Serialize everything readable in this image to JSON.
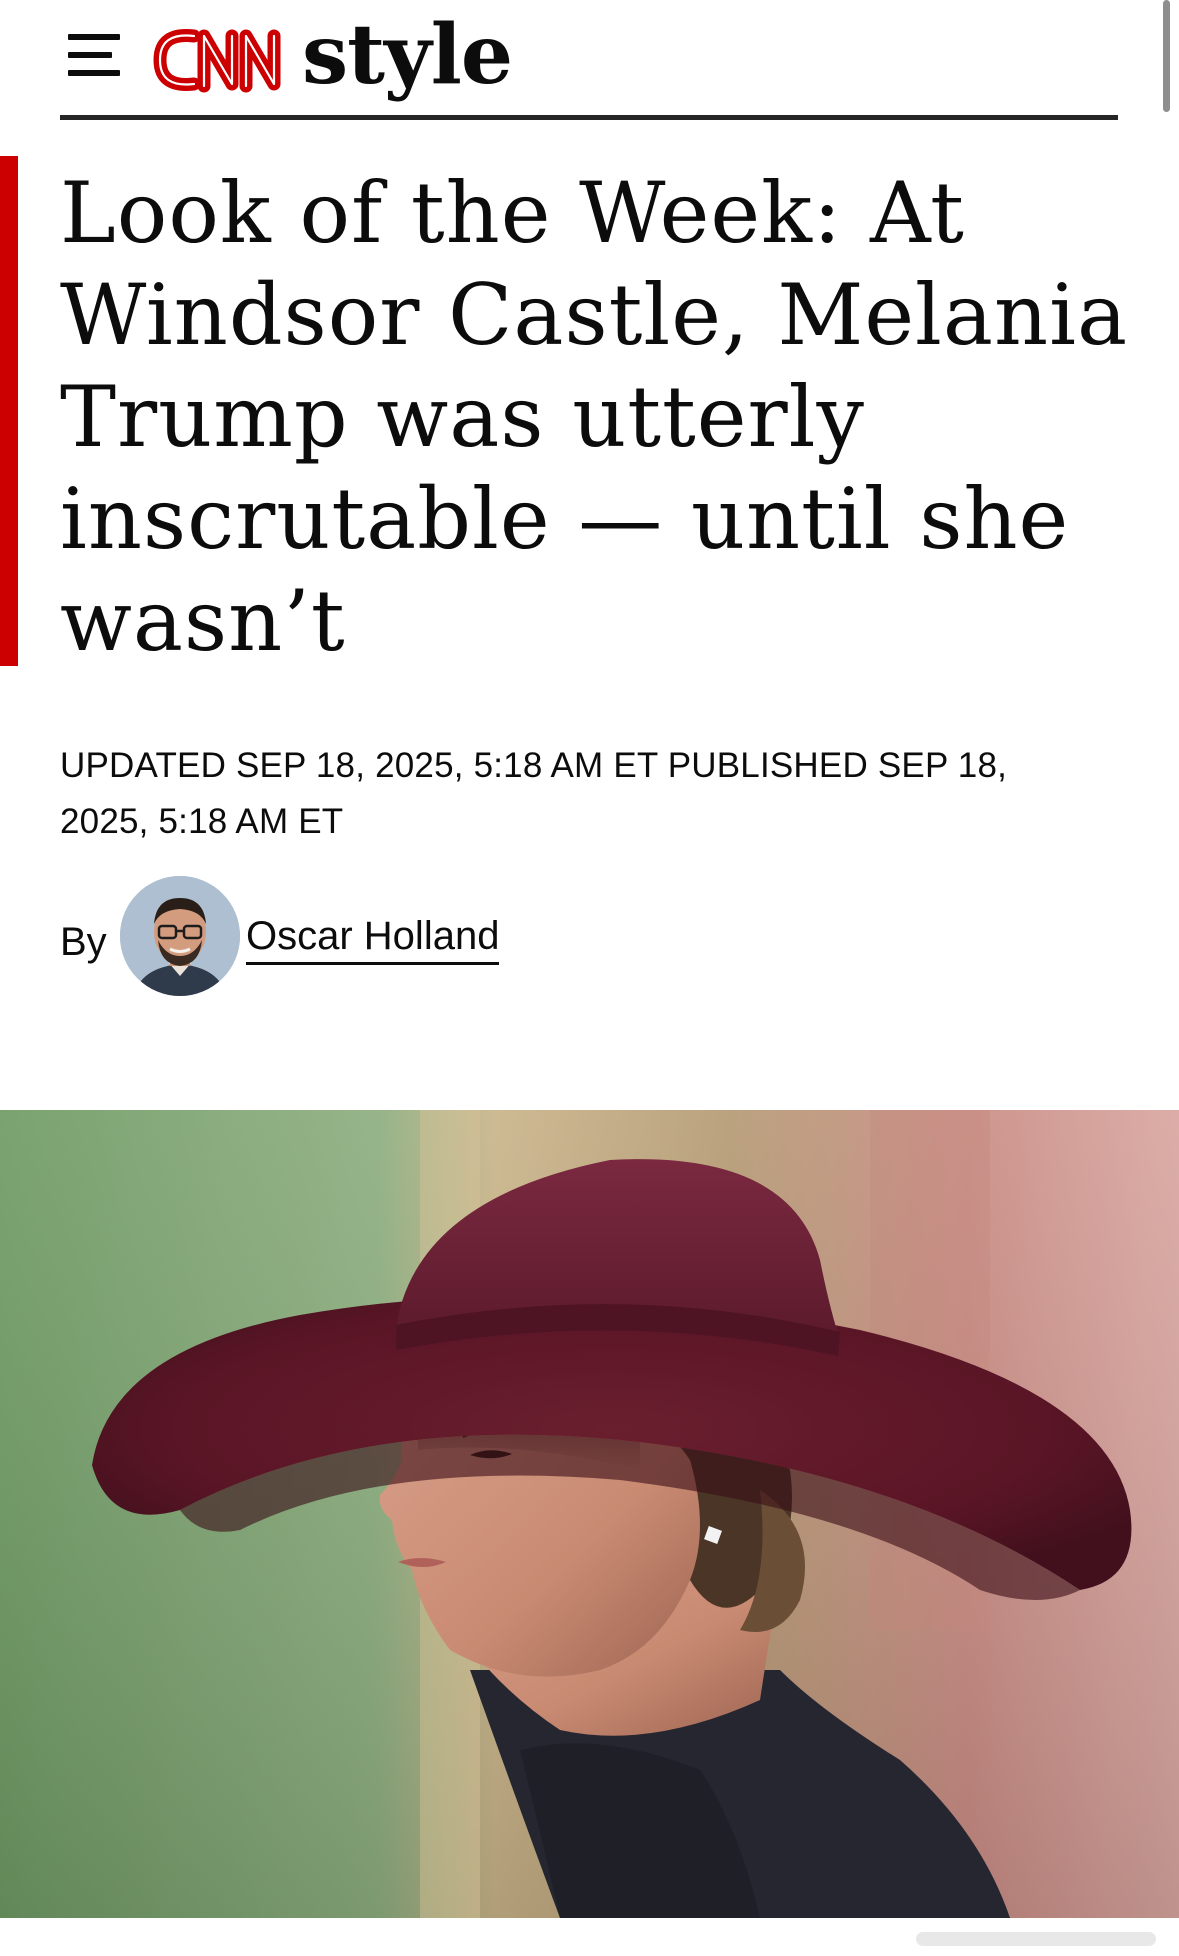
{
  "header": {
    "menu_icon": "hamburger-menu-icon",
    "logo_brand": "CNN",
    "logo_section": "style",
    "brand_color": "#cc0000"
  },
  "article": {
    "headline": "Look of the Week: At Windsor Castle, Melania Trump was utterly inscrutable — until she wasn’t",
    "timestamp": "Updated Sep 18, 2025, 5:18 AM ET Published Sep 18, 2025, 5:18 AM ET",
    "byline": {
      "prefix": "By",
      "author": "Oscar Holland"
    }
  }
}
